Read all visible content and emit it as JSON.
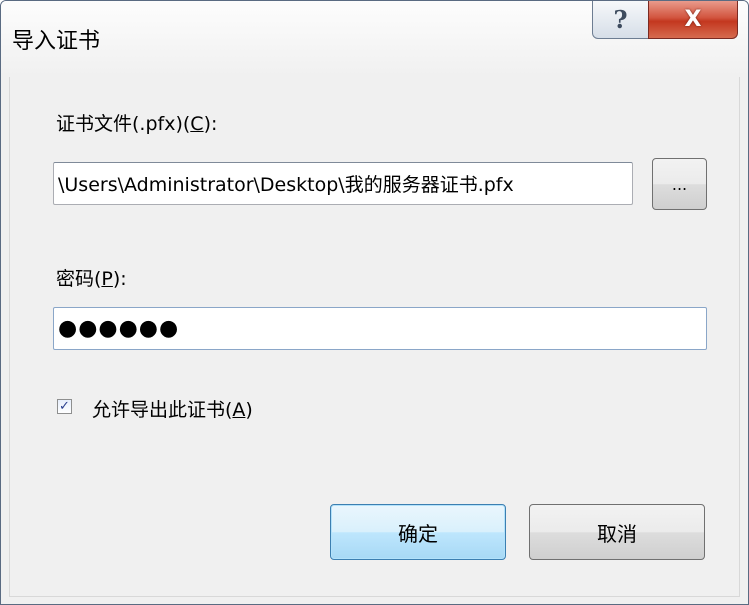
{
  "dialog": {
    "title": "导入证书",
    "help_glyph": "?",
    "close_glyph": "X"
  },
  "file": {
    "label_prefix": "证书文件(.pfx)(",
    "label_key": "C",
    "label_suffix": "):",
    "value": "\\Users\\Administrator\\Desktop\\我的服务器证书.pfx",
    "browse_label": "..."
  },
  "password": {
    "label_prefix": "密码(",
    "label_key": "P",
    "label_suffix": "):",
    "value": "●●●●●●"
  },
  "exportable": {
    "checked": true,
    "check_glyph": "✓",
    "label_prefix": "允许导出此证书(",
    "label_key": "A",
    "label_suffix": ")"
  },
  "buttons": {
    "ok": "确定",
    "cancel": "取消"
  }
}
